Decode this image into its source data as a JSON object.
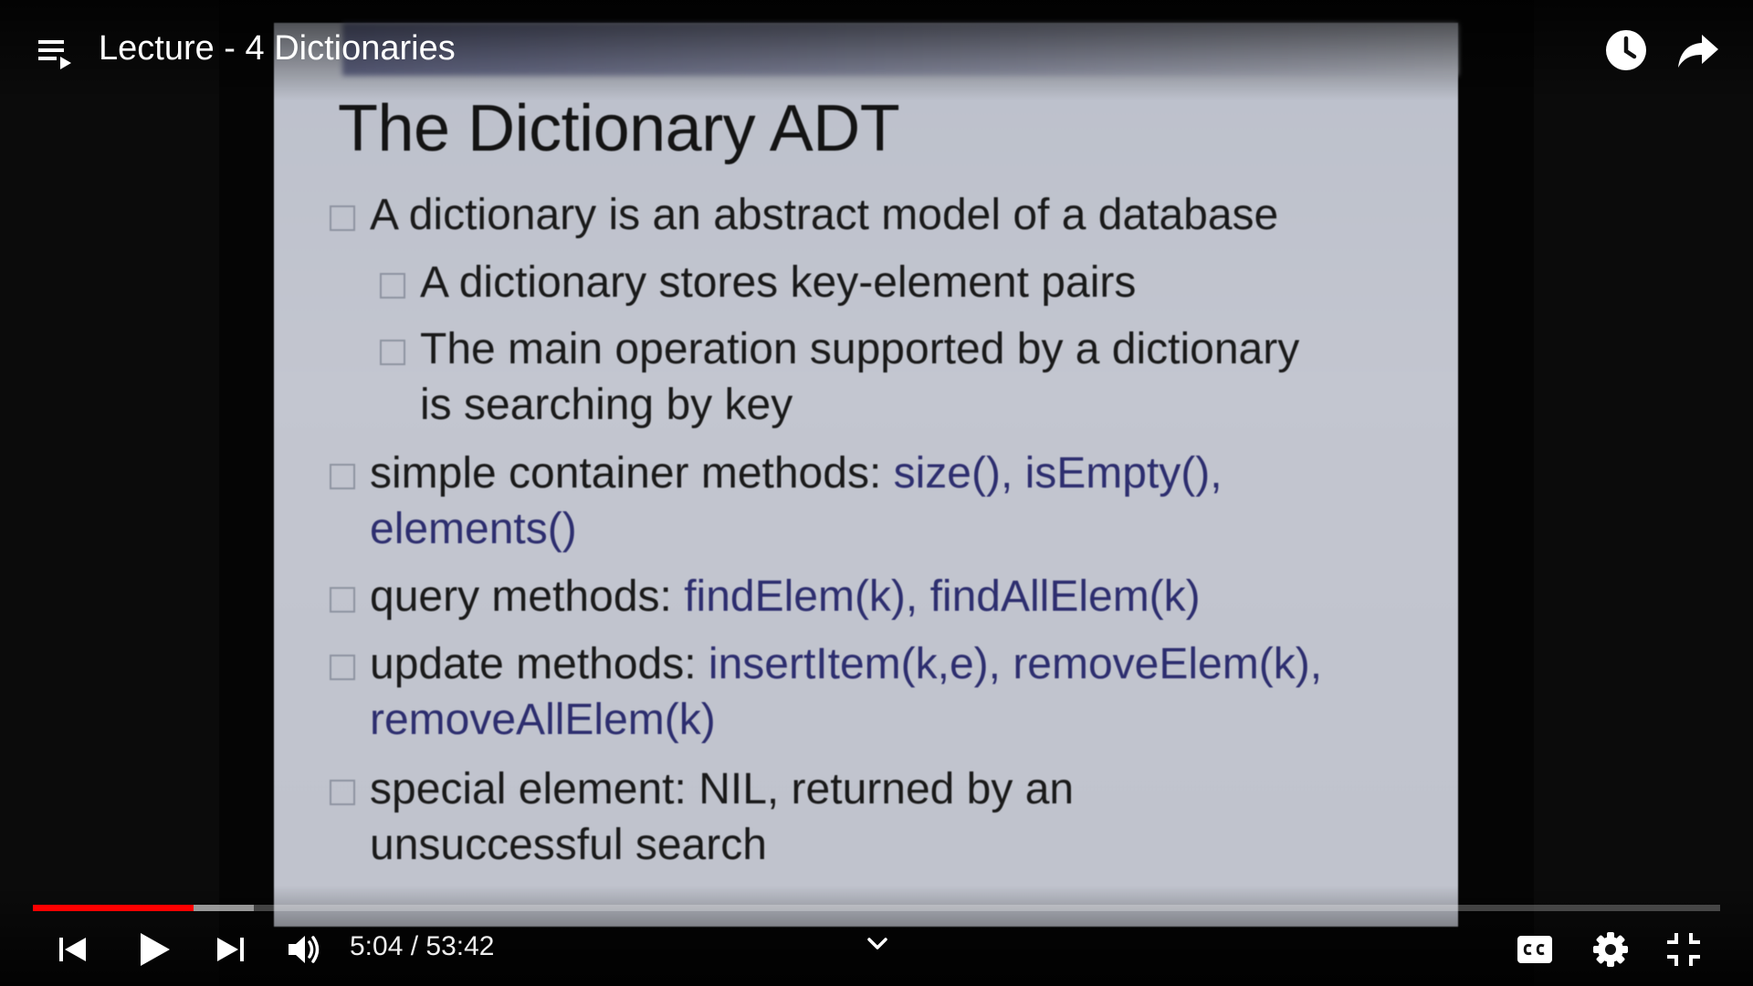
{
  "player": {
    "title": "Lecture - 4 Dictionaries",
    "time_current": "5:04",
    "time_separator": " / ",
    "time_total": "53:42",
    "progress": {
      "played_fraction": 0.095,
      "buffered_fraction": 0.131
    },
    "accent_color": "#ff0000",
    "icons": {
      "playlist": "playlist-icon",
      "watch_later": "clock-icon",
      "share": "share-icon",
      "previous": "previous-icon",
      "play": "play-icon",
      "next": "next-icon",
      "volume": "volume-icon",
      "chevron": "chevron-down-icon",
      "captions": "captions-icon",
      "settings": "gear-icon",
      "exit_fullscreen": "exit-fullscreen-icon"
    }
  },
  "slide": {
    "title": "The Dictionary ADT",
    "b1": "A dictionary is an abstract model of a database",
    "b1a": "A dictionary stores key-element pairs",
    "b1b_line1": "The main operation supported by a dictionary",
    "b1b_line2": "is searching by key",
    "b2_label": "simple container methods: ",
    "b2_methods_line1": "size(), isEmpty(),",
    "b2_methods_line2": "elements()",
    "b3_label": "query methods: ",
    "b3_methods": "findElem(k), findAllElem(k)",
    "b4_label": "update methods: ",
    "b4_methods_line1": "insertItem(k,e), removeElem(k),",
    "b4_methods_line2": "removeAllElem(k)",
    "b5_line1": "special element: NIL, returned by an",
    "b5_line2": "unsuccessful search"
  }
}
